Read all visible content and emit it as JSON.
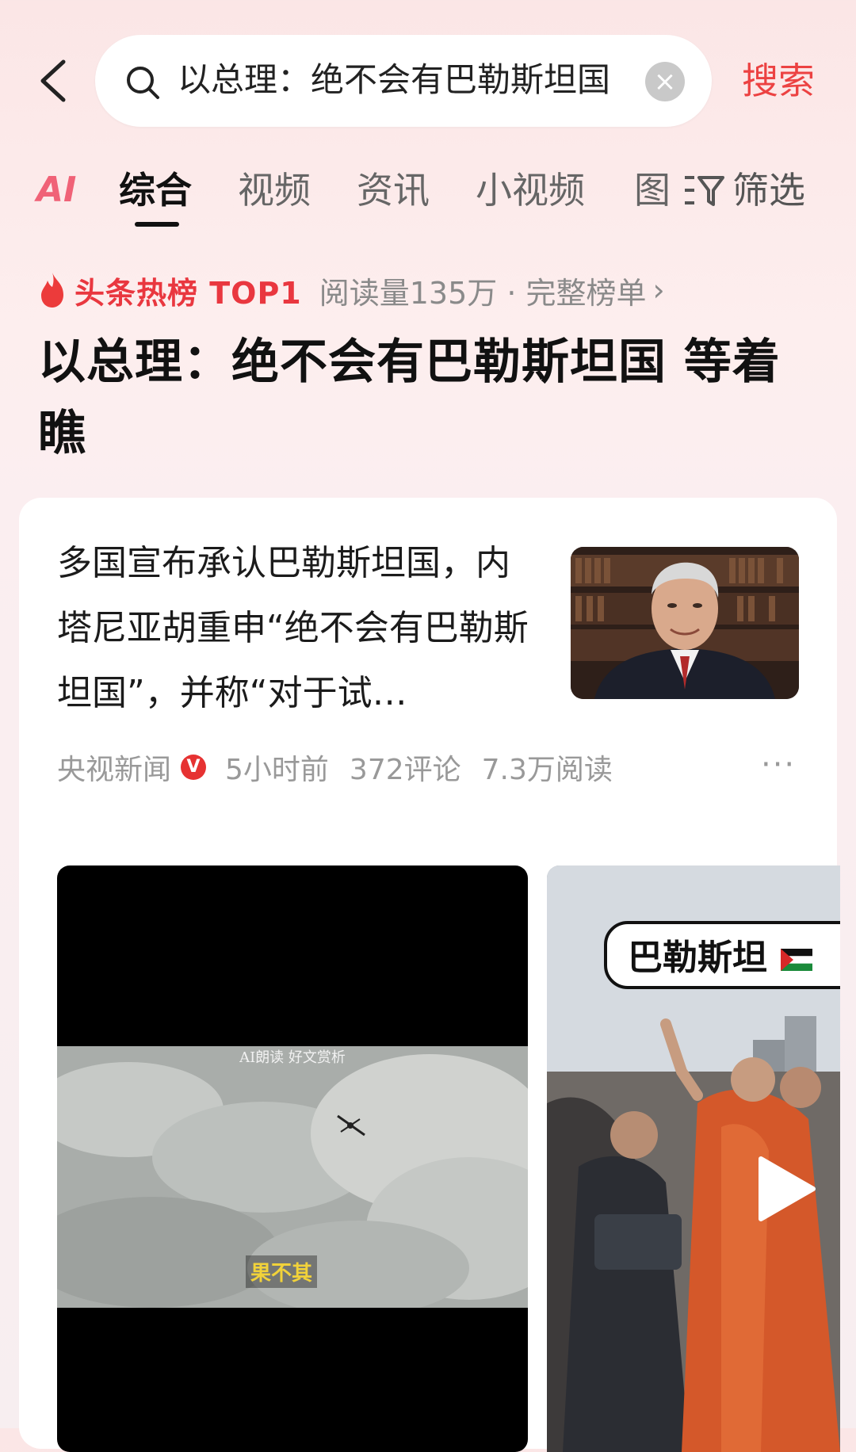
{
  "search": {
    "query": "以总理：绝不会有巴勒斯坦国 等着瞧",
    "visible_query": "以总理：绝不会有巴勒斯坦国",
    "button_label": "搜索"
  },
  "tabs": {
    "ai": "AI",
    "items": [
      "综合",
      "视频",
      "资讯",
      "小视频",
      "图"
    ],
    "active": "综合",
    "filter_label": "筛选"
  },
  "hot": {
    "badge": "头条热榜 TOP1",
    "meta": "阅读量135万 · 完整榜单"
  },
  "headline": "以总理：绝不会有巴勒斯坦国 等着瞧",
  "article": {
    "title": "多国宣布承认巴勒斯坦国，内塔尼亚胡重申“绝不会有巴勒斯坦国”，并称“对于试…",
    "source": "央视新闻",
    "verified_mark": "V",
    "time": "5小时前",
    "comments": "372评论",
    "reads": "7.3万阅读",
    "more": "···"
  },
  "videos": [
    {
      "caption_top": "AI朗读 好文赏析",
      "subtitle": "果不其"
    },
    {
      "bubble_text": "巴勒斯坦"
    }
  ],
  "colors": {
    "accent": "#ec4242",
    "hot_red": "#e9373f",
    "ai_gradient": "#f06277"
  },
  "icons": [
    "back-arrow-icon",
    "search-icon",
    "clear-icon",
    "filter-icon",
    "flame-icon",
    "chevron-right-icon",
    "verified-icon",
    "more-icon",
    "play-icon",
    "palestine-flag-icon"
  ]
}
